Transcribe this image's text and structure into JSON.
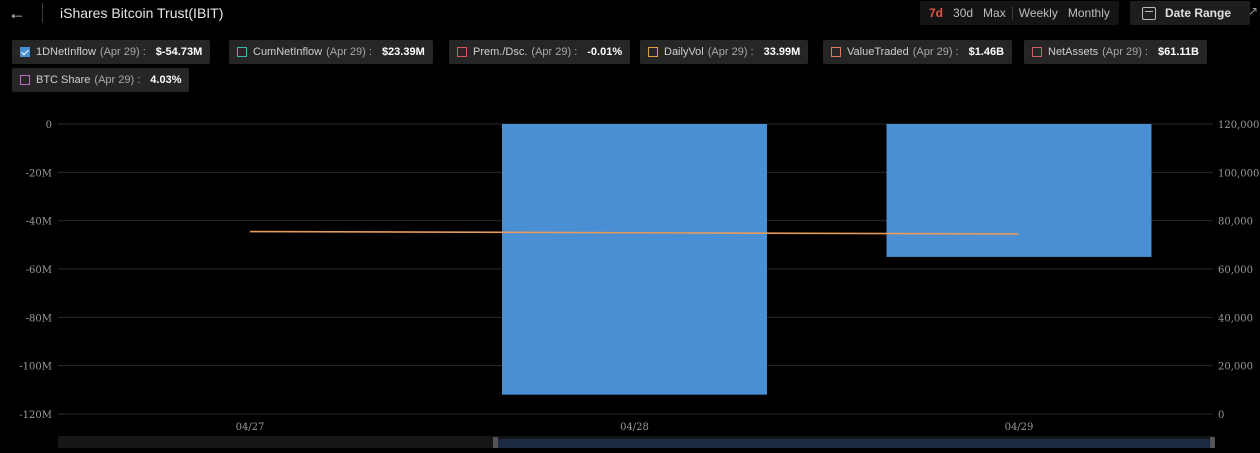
{
  "header": {
    "title": "iShares Bitcoin Trust(IBIT)",
    "periods": [
      "7d",
      "30d",
      "Max"
    ],
    "intervals": [
      "Weekly",
      "Monthly"
    ],
    "active_period": "7d",
    "date_range_label": "Date Range"
  },
  "legend": [
    {
      "name": "1DNetInflow",
      "date": "(Apr 29) :",
      "value": "$-54.73M",
      "checked": true,
      "color": "#4a8fd4"
    },
    {
      "name": "CumNetInflow",
      "date": "(Apr 29) :",
      "value": "$23.39M",
      "checked": false,
      "color": "#3fb8a8"
    },
    {
      "name": "Prem./Dsc.",
      "date": "(Apr 29) :",
      "value": "-0.01%",
      "checked": false,
      "color": "#d15b5b"
    },
    {
      "name": "DailyVol",
      "date": "(Apr 29) :",
      "value": "33.99M",
      "checked": false,
      "color": "#d9a24a"
    },
    {
      "name": "ValueTraded",
      "date": "(Apr 29) :",
      "value": "$1.46B",
      "checked": false,
      "color": "#e07a5f"
    },
    {
      "name": "NetAssets",
      "date": "(Apr 29) :",
      "value": "$61.11B",
      "checked": false,
      "color": "#d15b6e"
    },
    {
      "name": "BTC Share",
      "date": "(Apr 29) :",
      "value": "4.03%",
      "checked": false,
      "color": "#c06cc0"
    }
  ],
  "chart_data": {
    "type": "bar",
    "categories": [
      "04/27",
      "04/28",
      "04/29"
    ],
    "series": [
      {
        "axis": "left",
        "type": "bar",
        "color": "#4a8fd4",
        "values": [
          null,
          -112,
          -55
        ]
      },
      {
        "axis": "right",
        "type": "line",
        "color": "#e59a5a",
        "values": [
          75500,
          75000,
          74500
        ]
      }
    ],
    "left_axis": {
      "ticks": [
        "0",
        "-20M",
        "-40M",
        "-60M",
        "-80M",
        "-100M",
        "-120M"
      ],
      "ylim": [
        -120,
        0
      ]
    },
    "right_axis": {
      "ticks": [
        "120,000",
        "100,000",
        "80,000",
        "60,000",
        "40,000",
        "20,000",
        "0"
      ],
      "ylim": [
        0,
        120000
      ]
    },
    "grid": true
  }
}
